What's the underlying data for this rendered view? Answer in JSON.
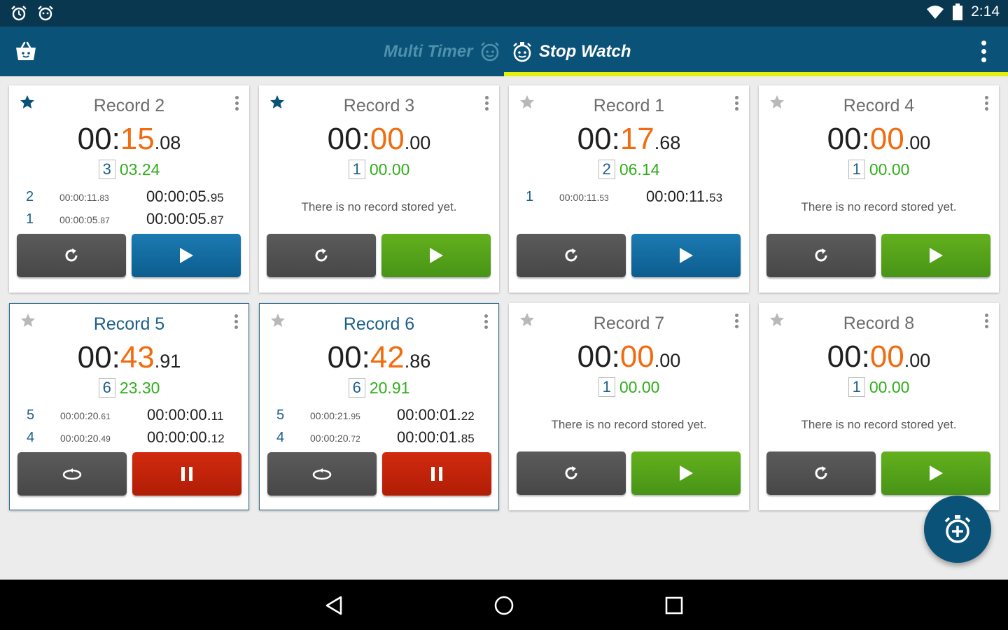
{
  "status_bar": {
    "time": "2:14"
  },
  "app_bar": {
    "tabs": [
      {
        "label": "Multi Timer",
        "active": false
      },
      {
        "label": "Stop Watch",
        "active": true
      }
    ]
  },
  "cards": [
    {
      "title": "Record 2",
      "starred": true,
      "active": false,
      "time": {
        "min": "00:",
        "sec": "15",
        "frac": ".08"
      },
      "lap": {
        "num": "3",
        "val": "03.24"
      },
      "records": [
        {
          "idx": "2",
          "total": "00:00:11.",
          "total_frac": "83",
          "split": "00:00:05.",
          "split_frac": "95"
        },
        {
          "idx": "1",
          "total": "00:00:05.",
          "total_frac": "87",
          "split": "00:00:05.",
          "split_frac": "87"
        }
      ],
      "empty_msg": "",
      "left_action": "reset",
      "right_action": "play",
      "right_color": "blue"
    },
    {
      "title": "Record 3",
      "starred": true,
      "active": false,
      "time": {
        "min": "00:",
        "sec": "00",
        "frac": ".00"
      },
      "lap": {
        "num": "1",
        "val": "00.00"
      },
      "records": [],
      "empty_msg": "There is no record stored yet.",
      "left_action": "reset",
      "right_action": "play",
      "right_color": "green"
    },
    {
      "title": "Record 1",
      "starred": false,
      "active": false,
      "time": {
        "min": "00:",
        "sec": "17",
        "frac": ".68"
      },
      "lap": {
        "num": "2",
        "val": "06.14"
      },
      "records": [
        {
          "idx": "1",
          "total": "00:00:11.",
          "total_frac": "53",
          "split": "00:00:11.",
          "split_frac": "53"
        }
      ],
      "empty_msg": "",
      "left_action": "reset",
      "right_action": "play",
      "right_color": "blue"
    },
    {
      "title": "Record 4",
      "starred": false,
      "active": false,
      "time": {
        "min": "00:",
        "sec": "00",
        "frac": ".00"
      },
      "lap": {
        "num": "1",
        "val": "00.00"
      },
      "records": [],
      "empty_msg": "There is no record stored yet.",
      "left_action": "reset",
      "right_action": "play",
      "right_color": "green"
    },
    {
      "title": "Record 5",
      "starred": false,
      "active": true,
      "time": {
        "min": "00:",
        "sec": "43",
        "frac": ".91"
      },
      "lap": {
        "num": "6",
        "val": "23.30"
      },
      "records": [
        {
          "idx": "5",
          "total": "00:00:20.",
          "total_frac": "61",
          "split": "00:00:00.",
          "split_frac": "11"
        },
        {
          "idx": "4",
          "total": "00:00:20.",
          "total_frac": "49",
          "split": "00:00:00.",
          "split_frac": "12"
        }
      ],
      "empty_msg": "",
      "left_action": "lap",
      "right_action": "pause",
      "right_color": "red"
    },
    {
      "title": "Record 6",
      "starred": false,
      "active": true,
      "time": {
        "min": "00:",
        "sec": "42",
        "frac": ".86"
      },
      "lap": {
        "num": "6",
        "val": "20.91"
      },
      "records": [
        {
          "idx": "5",
          "total": "00:00:21.",
          "total_frac": "95",
          "split": "00:00:01.",
          "split_frac": "22"
        },
        {
          "idx": "4",
          "total": "00:00:20.",
          "total_frac": "72",
          "split": "00:00:01.",
          "split_frac": "85"
        }
      ],
      "empty_msg": "",
      "left_action": "lap",
      "right_action": "pause",
      "right_color": "red"
    },
    {
      "title": "Record 7",
      "starred": false,
      "active": false,
      "time": {
        "min": "00:",
        "sec": "00",
        "frac": ".00"
      },
      "lap": {
        "num": "1",
        "val": "00.00"
      },
      "records": [],
      "empty_msg": "There is no record stored yet.",
      "left_action": "reset",
      "right_action": "play",
      "right_color": "green"
    },
    {
      "title": "Record 8",
      "starred": false,
      "active": false,
      "time": {
        "min": "00:",
        "sec": "00",
        "frac": ".00"
      },
      "lap": {
        "num": "1",
        "val": "00.00"
      },
      "records": [],
      "empty_msg": "There is no record stored yet.",
      "left_action": "reset",
      "right_action": "play",
      "right_color": "green"
    }
  ],
  "colors": {
    "status_bar": "#08374f",
    "app_bar": "#0a5277",
    "tab_indicator": "#e6ef0b",
    "seconds_orange": "#f26b0f",
    "lap_green": "#2fae1a",
    "play_blue": "#0c5d8e",
    "play_green": "#479417",
    "pause_red": "#b11d06"
  },
  "icons": {
    "status_left": [
      "alarm-icon",
      "alarm-icon"
    ],
    "status_right": [
      "wifi-icon",
      "battery-icon"
    ],
    "app_bar": [
      "store-bag-icon",
      "multi-timer-clock-icon",
      "stopwatch-icon",
      "overflow-menu-icon"
    ],
    "fab": "add-stopwatch-icon",
    "nav": [
      "back-icon",
      "home-icon",
      "recents-icon"
    ]
  }
}
